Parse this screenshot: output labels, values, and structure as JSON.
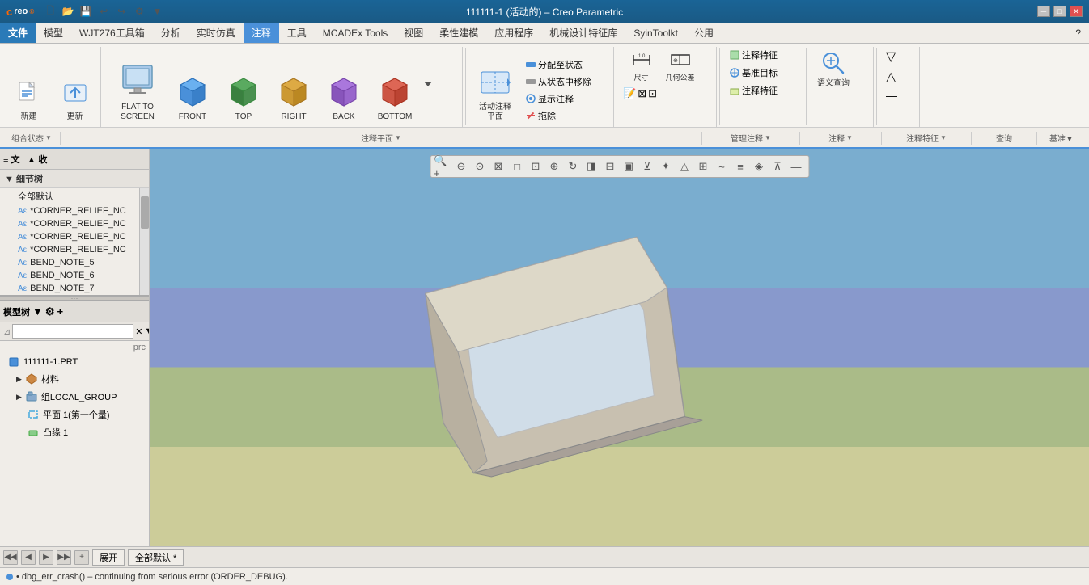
{
  "titlebar": {
    "logo": "creo",
    "title": "111111-1 (活动的) – Creo Parametric",
    "controls": [
      "–",
      "□",
      "×"
    ]
  },
  "menubar": {
    "items": [
      "文件",
      "模型",
      "WJT276工具箱",
      "分析",
      "实时仿真",
      "注释",
      "工具",
      "MCADEx Tools",
      "视图",
      "柔性建模",
      "应用程序",
      "机械设计特征库",
      "SyinToolkt",
      "公用"
    ],
    "active": "注释"
  },
  "ribbon": {
    "state_group": {
      "label": "组合状态",
      "dropdown": true
    },
    "view_buttons": [
      {
        "id": "flat_to_screen",
        "label": "FLAT TO\nSCREEN"
      },
      {
        "id": "front",
        "label": "FRONT"
      },
      {
        "id": "top",
        "label": "TOP"
      },
      {
        "id": "right",
        "label": "RIGHT"
      },
      {
        "id": "back",
        "label": "BACK"
      },
      {
        "id": "bottom",
        "label": "BOTTOM"
      }
    ],
    "active_annotation_plane": {
      "label": "活动注释\n平面",
      "sublabel": "注释平面"
    },
    "show_annotation": "显示注释",
    "distribute": "分配至状态",
    "move_from_state": "从状态中移除",
    "remove": "拖除",
    "manage_annotation": "管理注释",
    "dimension": "尺寸",
    "geometric_tolerance": "几何公差",
    "annotation_feature": "注释特征",
    "base_target": "基准目标",
    "annotation_feature2": "注释特征",
    "semantic_query": "语义查询",
    "query": "查询",
    "baseline": "基准"
  },
  "toolbar": {
    "new": "新建",
    "update": "更新"
  },
  "left_panel": {
    "tabs": [
      "≡ 文",
      "▲ 收"
    ],
    "tree_sections": [
      {
        "label": "▼ 细节树",
        "items": [
          "全部默认",
          "*CORNER_RELIEF_NC",
          "*CORNER_RELIEF_NC",
          "*CORNER_RELIEF_NC",
          "*CORNER_RELIEF_NC",
          "BEND_NOTE_5",
          "BEND_NOTE_6",
          "BEND_NOTE_7"
        ]
      }
    ]
  },
  "model_tree": {
    "header": "模型树",
    "controls": [
      "filter-icon",
      "settings-icon",
      "add-icon"
    ],
    "search_placeholder": "",
    "items": [
      {
        "id": "root",
        "label": "111111-1.PRT",
        "level": 0,
        "expandable": false,
        "icon": "part"
      },
      {
        "id": "material",
        "label": "材料",
        "level": 1,
        "expandable": true,
        "icon": "material"
      },
      {
        "id": "local_group",
        "label": "组LOCAL_GROUP",
        "level": 1,
        "expandable": true,
        "icon": "group"
      },
      {
        "id": "plane1",
        "label": "平面 1(第一个量)",
        "level": 1,
        "expandable": false,
        "icon": "plane"
      },
      {
        "id": "boss1",
        "label": "凸缘 1",
        "level": 1,
        "expandable": false,
        "icon": "feature"
      }
    ]
  },
  "viewport_toolbar": {
    "buttons": [
      "🔍+",
      "🔍-",
      "⊙",
      "□",
      "□+",
      "⊡",
      "⊡+",
      "⊠",
      "⊞",
      "~",
      "↺",
      "⇄",
      "⊻",
      "✕",
      "⊤",
      "△",
      "✦",
      "▣",
      "⬚",
      "—"
    ]
  },
  "viewport": {
    "model_name": "111111-1"
  },
  "bottombar": {
    "nav_buttons": [
      "◀◀",
      "◀",
      "▶",
      "▶▶"
    ],
    "expand_label": "展开",
    "default_label": "全部默认 *"
  },
  "statusbar": {
    "message": "• dbg_err_crash() – continuing from serious error (ORDER_DEBUG)."
  }
}
